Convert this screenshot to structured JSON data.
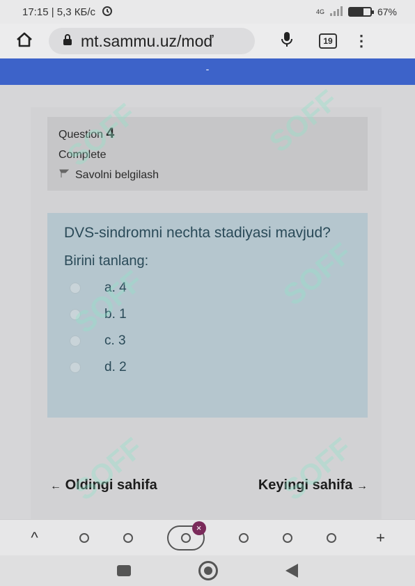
{
  "status_bar": {
    "time_speed": "17:15 | 5,3 КБ/с",
    "network": "4G",
    "battery": "67%",
    "battery_level": 0.67
  },
  "browser": {
    "url": "mt.sammu.uz/moď",
    "tab_count": "19"
  },
  "banner": {
    "text": "-"
  },
  "question_info": {
    "label": "Question",
    "number": "4",
    "state": "Complete",
    "flag_label": "Savolni belgilash"
  },
  "question": {
    "text": "DVS-sindromni nechta stadiyasi mavjud?",
    "prompt": "Birini tanlang:",
    "options": [
      {
        "label": "a. 4"
      },
      {
        "label": "b. 1"
      },
      {
        "label": "c. 3"
      },
      {
        "label": "d. 2"
      }
    ]
  },
  "navigation": {
    "prev_label": "Oldingi sahifa",
    "prev_arrow": "←",
    "next_label": "Keyingi sahifa",
    "next_arrow": "→"
  },
  "bottom_toolbar": {
    "collapse": "^",
    "new_tab": "+",
    "close": "×"
  },
  "watermark": {
    "text": "SOFF"
  },
  "icons": [
    "home-icon",
    "lock-icon",
    "mic-icon",
    "tabs-icon",
    "menu-icon",
    "flag-icon",
    "alarm-icon",
    "battery-icon"
  ]
}
